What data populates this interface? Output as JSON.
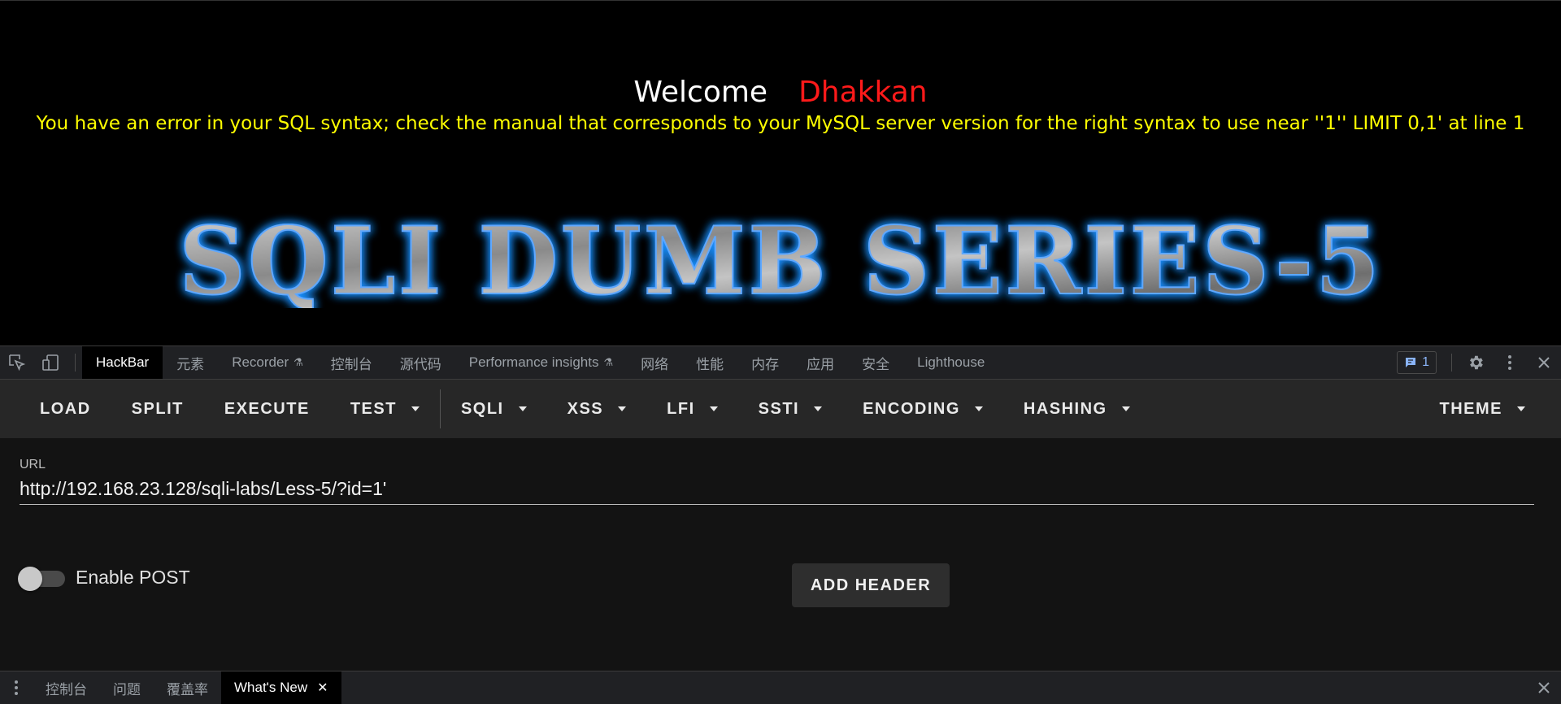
{
  "page": {
    "welcome": "Welcome",
    "user_name": "Dhakkan",
    "sql_error": "You have an error in your SQL syntax; check the manual that corresponds to your MySQL server version for the right syntax to use near ''1'' LIMIT 0,1' at line 1",
    "banner": "SQLI DUMB SERIES-5"
  },
  "devtools": {
    "tabs": [
      {
        "label": "HackBar",
        "active": true
      },
      {
        "label": "元素"
      },
      {
        "label": "Recorder",
        "flask": true
      },
      {
        "label": "控制台"
      },
      {
        "label": "源代码"
      },
      {
        "label": "Performance insights",
        "flask": true
      },
      {
        "label": "网络"
      },
      {
        "label": "性能"
      },
      {
        "label": "内存"
      },
      {
        "label": "应用"
      },
      {
        "label": "安全"
      },
      {
        "label": "Lighthouse"
      }
    ],
    "issues_count": "1"
  },
  "hackbar": {
    "buttons": [
      "LOAD",
      "SPLIT",
      "EXECUTE",
      "TEST"
    ],
    "menus": [
      "SQLI",
      "XSS",
      "LFI",
      "SSTI",
      "ENCODING",
      "HASHING"
    ],
    "theme": "THEME",
    "url_label": "URL",
    "url_value": "http://192.168.23.128/sqli-labs/Less-5/?id=1'",
    "enable_post_label": "Enable POST",
    "enable_post": false,
    "add_header": "ADD HEADER"
  },
  "drawer": {
    "tabs": [
      {
        "label": "控制台"
      },
      {
        "label": "问题"
      },
      {
        "label": "覆盖率"
      },
      {
        "label": "What's New",
        "active": true,
        "closable": true
      }
    ]
  },
  "colors": {
    "welcome": "#ffffff",
    "user_name": "#ff1a1a",
    "sql_error": "#ffff00",
    "banner_glow": "#1e90ff",
    "issues_icon": "#8ab4f8"
  },
  "icons": [
    "inspect-element-icon",
    "device-toolbar-icon",
    "flask-icon",
    "message-icon",
    "settings-icon",
    "more-vertical-icon",
    "close-icon",
    "caret-down-icon"
  ]
}
